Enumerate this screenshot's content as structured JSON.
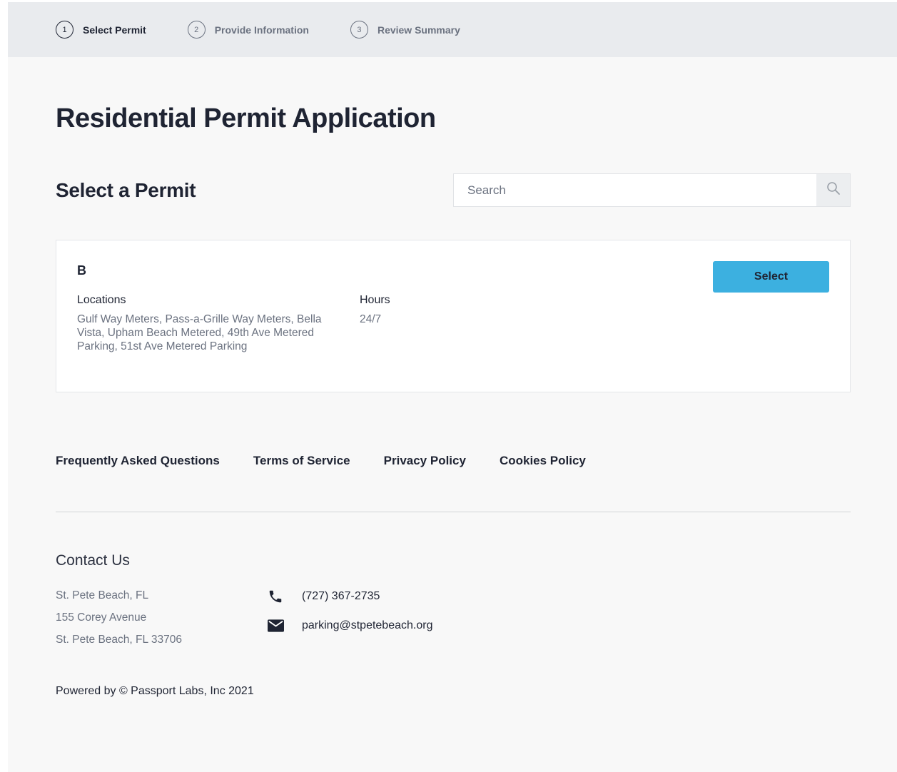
{
  "stepper": {
    "steps": [
      {
        "number": "1",
        "label": "Select Permit",
        "active": true
      },
      {
        "number": "2",
        "label": "Provide Information",
        "active": false
      },
      {
        "number": "3",
        "label": "Review Summary",
        "active": false
      }
    ]
  },
  "page": {
    "title": "Residential Permit Application",
    "section_title": "Select a Permit"
  },
  "search": {
    "placeholder": "Search",
    "value": "",
    "icon": "search-icon"
  },
  "permit": {
    "name": "B",
    "locations_label": "Locations",
    "locations_value": "Gulf Way Meters, Pass-a-Grille Way Meters, Bella Vista, Upham Beach Metered, 49th Ave Metered Parking, 51st Ave Metered Parking",
    "hours_label": "Hours",
    "hours_value": "24/7",
    "select_label": "Select"
  },
  "footer": {
    "links": [
      "Frequently Asked Questions",
      "Terms of Service",
      "Privacy Policy",
      "Cookies Policy"
    ],
    "contact_title": "Contact Us",
    "address": [
      "St. Pete Beach, FL",
      "155 Corey Avenue",
      "St. Pete Beach, FL 33706"
    ],
    "phone": "(727) 367-2735",
    "email": "parking@stpetebeach.org",
    "powered_by": "Powered by © Passport Labs, Inc 2021"
  },
  "colors": {
    "accent": "#3cb0e0",
    "text": "#1f2433",
    "muted": "#6b7280",
    "header_bg": "#e9ebee",
    "page_bg": "#f8f8f8"
  }
}
